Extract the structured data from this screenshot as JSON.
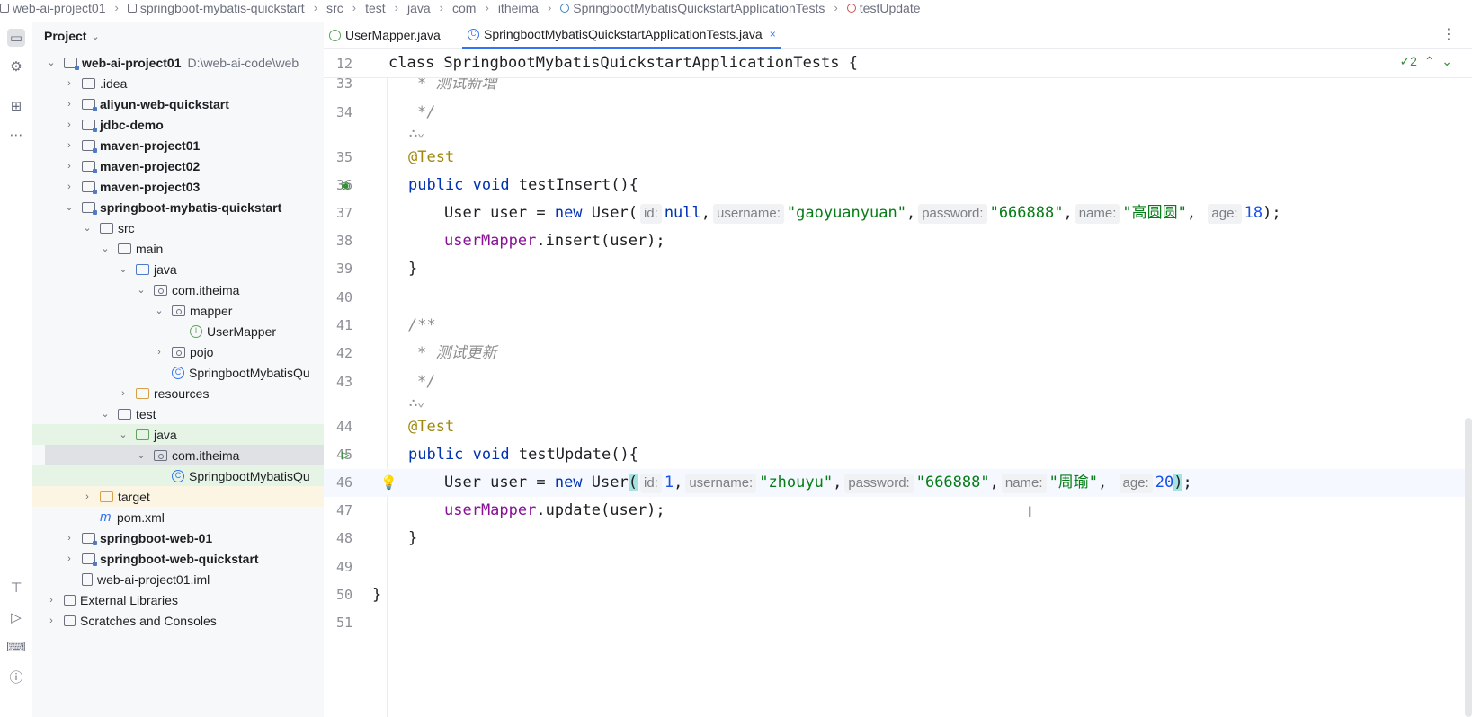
{
  "breadcrumb": [
    "web-ai-project01",
    "springboot-mybatis-quickstart",
    "src",
    "test",
    "java",
    "com",
    "itheima",
    "SpringbootMybatisQuickstartApplicationTests",
    "testUpdate"
  ],
  "panel": {
    "title": "Project"
  },
  "tree": [
    {
      "label": "web-ai-project01",
      "path": "D:\\web-ai-code\\web"
    },
    {
      "label": ".idea"
    },
    {
      "label": "aliyun-web-quickstart"
    },
    {
      "label": "jdbc-demo"
    },
    {
      "label": "maven-project01"
    },
    {
      "label": "maven-project02"
    },
    {
      "label": "maven-project03"
    },
    {
      "label": "springboot-mybatis-quickstart"
    },
    {
      "label": "src"
    },
    {
      "label": "main"
    },
    {
      "label": "java"
    },
    {
      "label": "com.itheima"
    },
    {
      "label": "mapper"
    },
    {
      "label": "UserMapper"
    },
    {
      "label": "pojo"
    },
    {
      "label": "SpringbootMybatisQu"
    },
    {
      "label": "resources"
    },
    {
      "label": "test"
    },
    {
      "label": "java"
    },
    {
      "label": "com.itheima"
    },
    {
      "label": "SpringbootMybatisQu"
    },
    {
      "label": "target"
    },
    {
      "label": "pom.xml"
    },
    {
      "label": "springboot-web-01"
    },
    {
      "label": "springboot-web-quickstart"
    },
    {
      "label": "web-ai-project01.iml"
    },
    {
      "label": "External Libraries"
    },
    {
      "label": "Scratches and Consoles"
    }
  ],
  "tabs": [
    {
      "label": "UserMapper.java"
    },
    {
      "label": "SpringbootMybatisQuickstartApplicationTests.java"
    }
  ],
  "editor": {
    "inspection_count": "2",
    "lines": {
      "sticky": {
        "n": "12",
        "text": "class SpringbootMybatisQuickstartApplicationTests {"
      },
      "l33": {
        "n": "33",
        "text": "* 测试新增"
      },
      "l34": {
        "n": "34",
        "text": "*/"
      },
      "l35": {
        "n": "35",
        "text": "@Test"
      },
      "l36": {
        "n": "36"
      },
      "l37": {
        "n": "37",
        "hints": [
          "id:",
          "username:",
          "password:",
          "name:",
          "age:"
        ],
        "values": [
          "null",
          "\"gaoyuanyuan\"",
          "\"666888\"",
          "\"高圆圆\"",
          "18"
        ]
      },
      "l38": {
        "n": "38"
      },
      "l39": {
        "n": "39"
      },
      "l40": {
        "n": "40"
      },
      "l41": {
        "n": "41",
        "text": "/**"
      },
      "l42": {
        "n": "42",
        "text": "* 测试更新"
      },
      "l43": {
        "n": "43",
        "text": "*/"
      },
      "l44": {
        "n": "44",
        "text": "@Test"
      },
      "l45": {
        "n": "45"
      },
      "l46": {
        "n": "46",
        "hints": [
          "id:",
          "username:",
          "password:",
          "name:",
          "age:"
        ],
        "values": [
          "1",
          "\"zhouyu\"",
          "\"666888\"",
          "\"周瑜\"",
          "20"
        ]
      },
      "l47": {
        "n": "47"
      },
      "l48": {
        "n": "48"
      },
      "l49": {
        "n": "49"
      },
      "l50": {
        "n": "50"
      },
      "l51": {
        "n": "51"
      }
    }
  }
}
